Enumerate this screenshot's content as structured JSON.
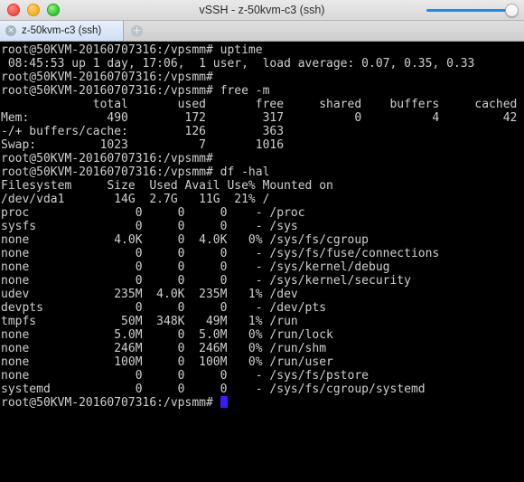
{
  "window": {
    "title": "vSSH - z-50kvm-c3 (ssh)",
    "traffic_lights": {
      "close": "close",
      "minimize": "minimize",
      "zoom": "zoom"
    },
    "slider": {
      "value": 100,
      "accent_color": "#1e8bf5"
    }
  },
  "tabbar": {
    "tabs": [
      {
        "label": "z-50kvm-c3 (ssh)",
        "close_glyph": "×",
        "active": true
      }
    ],
    "add_tab_glyph": "+"
  },
  "terminal": {
    "colors": {
      "background": "#000000",
      "foreground": "#d0d0d0",
      "cursor": "#3f18ff"
    },
    "prompt": "root@50KVM-20160707316:/vpsmm# ",
    "lines": [
      "root@50KVM-20160707316:/vpsmm# uptime",
      " 08:45:53 up 1 day, 17:06,  1 user,  load average: 0.07, 0.35, 0.33",
      "root@50KVM-20160707316:/vpsmm#",
      "root@50KVM-20160707316:/vpsmm# free -m",
      "             total       used       free     shared    buffers     cached",
      "Mem:           490        172        317          0          4         42",
      "-/+ buffers/cache:        126        363",
      "Swap:         1023          7       1016",
      "root@50KVM-20160707316:/vpsmm#",
      "root@50KVM-20160707316:/vpsmm# df -hal",
      "Filesystem     Size  Used Avail Use% Mounted on",
      "/dev/vda1       14G  2.7G   11G  21% /",
      "proc               0     0     0    - /proc",
      "sysfs              0     0     0    - /sys",
      "none            4.0K     0  4.0K   0% /sys/fs/cgroup",
      "none               0     0     0    - /sys/fs/fuse/connections",
      "none               0     0     0    - /sys/kernel/debug",
      "none               0     0     0    - /sys/kernel/security",
      "udev            235M  4.0K  235M   1% /dev",
      "devpts             0     0     0    - /dev/pts",
      "tmpfs            50M  348K   49M   1% /run",
      "none            5.0M     0  5.0M   0% /run/lock",
      "none            246M     0  246M   0% /run/shm",
      "none            100M     0  100M   0% /run/user",
      "none               0     0     0    - /sys/fs/pstore",
      "systemd            0     0     0    - /sys/fs/cgroup/systemd"
    ],
    "final_prompt": "root@50KVM-20160707316:/vpsmm# "
  },
  "command_output": {
    "uptime": {
      "command": "uptime",
      "time": "08:45:53",
      "up": "1 day, 17:06",
      "users": "1 user",
      "load_average": [
        0.07,
        0.35,
        0.33
      ]
    },
    "free": {
      "command": "free -m",
      "columns": [
        "total",
        "used",
        "free",
        "shared",
        "buffers",
        "cached"
      ],
      "rows": [
        {
          "label": "Mem:",
          "values": [
            "490",
            "172",
            "317",
            "0",
            "4",
            "42"
          ]
        },
        {
          "label": "-/+ buffers/cache:",
          "values": [
            "126",
            "363"
          ]
        },
        {
          "label": "Swap:",
          "values": [
            "1023",
            "7",
            "1016"
          ]
        }
      ]
    },
    "df": {
      "command": "df -hal",
      "columns": [
        "Filesystem",
        "Size",
        "Used",
        "Avail",
        "Use%",
        "Mounted on"
      ],
      "rows": [
        {
          "filesystem": "/dev/vda1",
          "size": "14G",
          "used": "2.7G",
          "avail": "11G",
          "use": "21%",
          "mount": "/"
        },
        {
          "filesystem": "proc",
          "size": "0",
          "used": "0",
          "avail": "0",
          "use": "-",
          "mount": "/proc"
        },
        {
          "filesystem": "sysfs",
          "size": "0",
          "used": "0",
          "avail": "0",
          "use": "-",
          "mount": "/sys"
        },
        {
          "filesystem": "none",
          "size": "4.0K",
          "used": "0",
          "avail": "4.0K",
          "use": "0%",
          "mount": "/sys/fs/cgroup"
        },
        {
          "filesystem": "none",
          "size": "0",
          "used": "0",
          "avail": "0",
          "use": "-",
          "mount": "/sys/fs/fuse/connections"
        },
        {
          "filesystem": "none",
          "size": "0",
          "used": "0",
          "avail": "0",
          "use": "-",
          "mount": "/sys/kernel/debug"
        },
        {
          "filesystem": "none",
          "size": "0",
          "used": "0",
          "avail": "0",
          "use": "-",
          "mount": "/sys/kernel/security"
        },
        {
          "filesystem": "udev",
          "size": "235M",
          "used": "4.0K",
          "avail": "235M",
          "use": "1%",
          "mount": "/dev"
        },
        {
          "filesystem": "devpts",
          "size": "0",
          "used": "0",
          "avail": "0",
          "use": "-",
          "mount": "/dev/pts"
        },
        {
          "filesystem": "tmpfs",
          "size": "50M",
          "used": "348K",
          "avail": "49M",
          "use": "1%",
          "mount": "/run"
        },
        {
          "filesystem": "none",
          "size": "5.0M",
          "used": "0",
          "avail": "5.0M",
          "use": "0%",
          "mount": "/run/lock"
        },
        {
          "filesystem": "none",
          "size": "246M",
          "used": "0",
          "avail": "246M",
          "use": "0%",
          "mount": "/run/shm"
        },
        {
          "filesystem": "none",
          "size": "100M",
          "used": "0",
          "avail": "100M",
          "use": "0%",
          "mount": "/run/user"
        },
        {
          "filesystem": "none",
          "size": "0",
          "used": "0",
          "avail": "0",
          "use": "-",
          "mount": "/sys/fs/pstore"
        },
        {
          "filesystem": "systemd",
          "size": "0",
          "used": "0",
          "avail": "0",
          "use": "-",
          "mount": "/sys/fs/cgroup/systemd"
        }
      ]
    }
  }
}
